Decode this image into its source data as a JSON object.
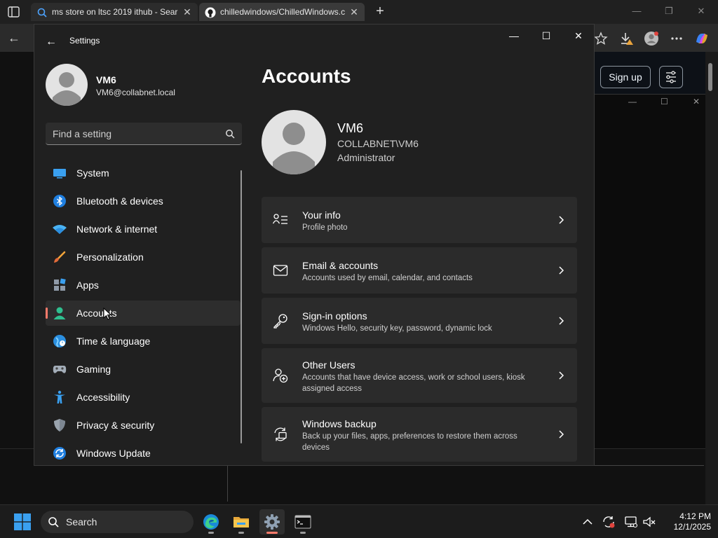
{
  "browser": {
    "tabs": [
      {
        "label": "ms store on ltsc 2019 ithub - Sear",
        "icon": "search-icon"
      },
      {
        "label": "chilledwindows/ChilledWindows.c",
        "icon": "github-icon"
      }
    ],
    "github": {
      "signup_label": "Sign up"
    }
  },
  "settings": {
    "title": "Settings",
    "profile": {
      "name": "VM6",
      "email": "VM6@collabnet.local"
    },
    "search": {
      "placeholder": "Find a setting"
    },
    "nav": [
      {
        "label": "System",
        "icon": "system-icon"
      },
      {
        "label": "Bluetooth & devices",
        "icon": "bluetooth-icon"
      },
      {
        "label": "Network & internet",
        "icon": "wifi-icon"
      },
      {
        "label": "Personalization",
        "icon": "brush-icon"
      },
      {
        "label": "Apps",
        "icon": "apps-icon"
      },
      {
        "label": "Accounts",
        "icon": "accounts-icon",
        "active": true
      },
      {
        "label": "Time & language",
        "icon": "globe-icon"
      },
      {
        "label": "Gaming",
        "icon": "gamepad-icon"
      },
      {
        "label": "Accessibility",
        "icon": "accessibility-icon"
      },
      {
        "label": "Privacy & security",
        "icon": "shield-icon"
      },
      {
        "label": "Windows Update",
        "icon": "update-icon"
      }
    ],
    "page": {
      "title": "Accounts",
      "account": {
        "name": "VM6",
        "domain": "COLLABNET\\VM6",
        "role": "Administrator"
      },
      "cards": [
        {
          "title": "Your info",
          "subtitle": "Profile photo",
          "icon": "person-info-icon"
        },
        {
          "title": "Email & accounts",
          "subtitle": "Accounts used by email, calendar, and contacts",
          "icon": "mail-icon"
        },
        {
          "title": "Sign-in options",
          "subtitle": "Windows Hello, security key, password, dynamic lock",
          "icon": "key-icon"
        },
        {
          "title": "Other Users",
          "subtitle": "Accounts that have device access, work or school users, kiosk assigned access",
          "icon": "add-user-icon"
        },
        {
          "title": "Windows backup",
          "subtitle": "Back up your files, apps, preferences to restore them across devices",
          "icon": "backup-icon"
        }
      ]
    }
  },
  "taskbar": {
    "search_label": "Search",
    "time": "4:12 PM",
    "date": "12/1/2025"
  },
  "colors": {
    "accent": "#ff7b6b",
    "window_bg": "#202020",
    "card_bg": "#2b2b2b"
  }
}
